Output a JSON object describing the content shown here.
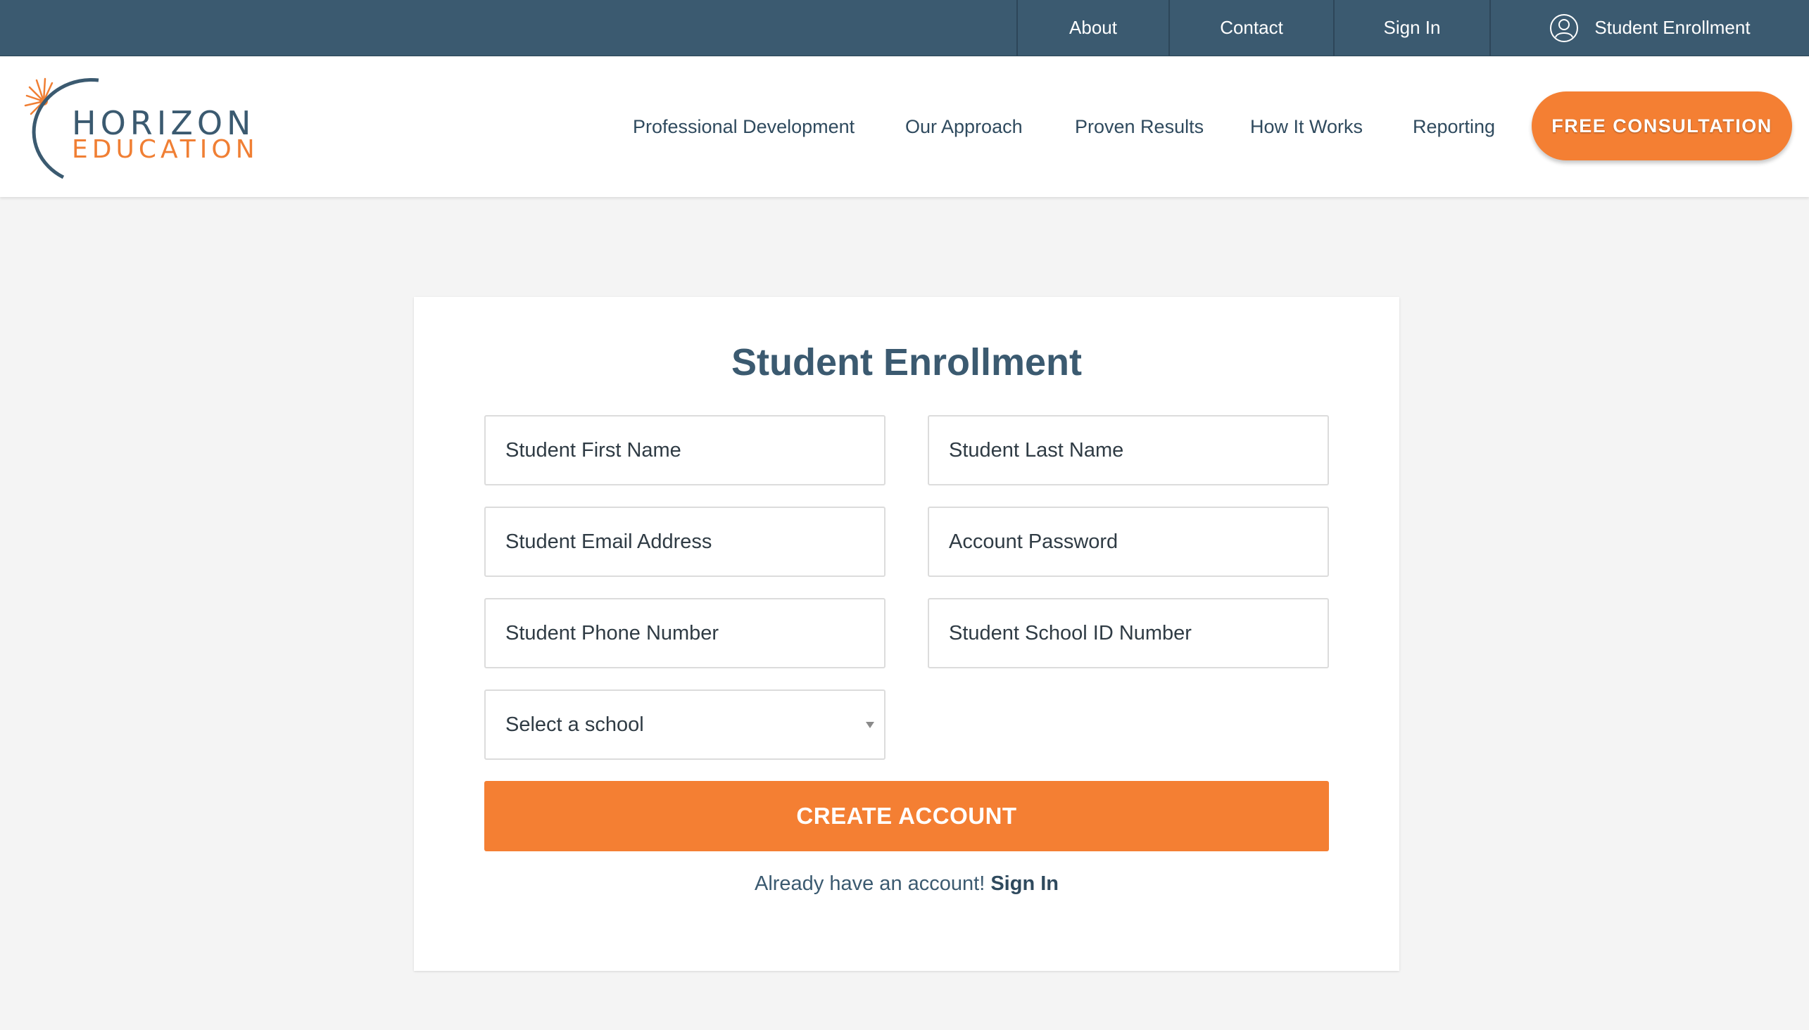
{
  "topbar": {
    "about": "About",
    "contact": "Contact",
    "sign_in": "Sign In",
    "student_enrollment": "Student Enrollment"
  },
  "logo": {
    "line1": "HORIZON",
    "line2": "EDUCATION"
  },
  "nav": {
    "items": [
      "Professional Development",
      "Our Approach",
      "Proven Results",
      "How It Works",
      "Reporting"
    ],
    "cta": "FREE CONSULTATION"
  },
  "form": {
    "title": "Student Enrollment",
    "first_name_placeholder": "Student First Name",
    "last_name_placeholder": "Student Last Name",
    "email_placeholder": "Student Email Address",
    "password_placeholder": "Account Password",
    "phone_placeholder": "Student Phone Number",
    "school_id_placeholder": "Student School ID Number",
    "school_select_value": "Select a school",
    "submit_label": "CREATE ACCOUNT",
    "signin_prompt": "Already have an account!",
    "signin_link": "Sign In"
  },
  "colors": {
    "topbar_bg": "#3b5a70",
    "accent_orange": "#f47f33",
    "heading": "#3b5a70",
    "page_bg": "#f4f4f4"
  },
  "icons": {
    "topbar_enrollment": "user-circle-icon",
    "select_caret": "caret-down-icon"
  }
}
